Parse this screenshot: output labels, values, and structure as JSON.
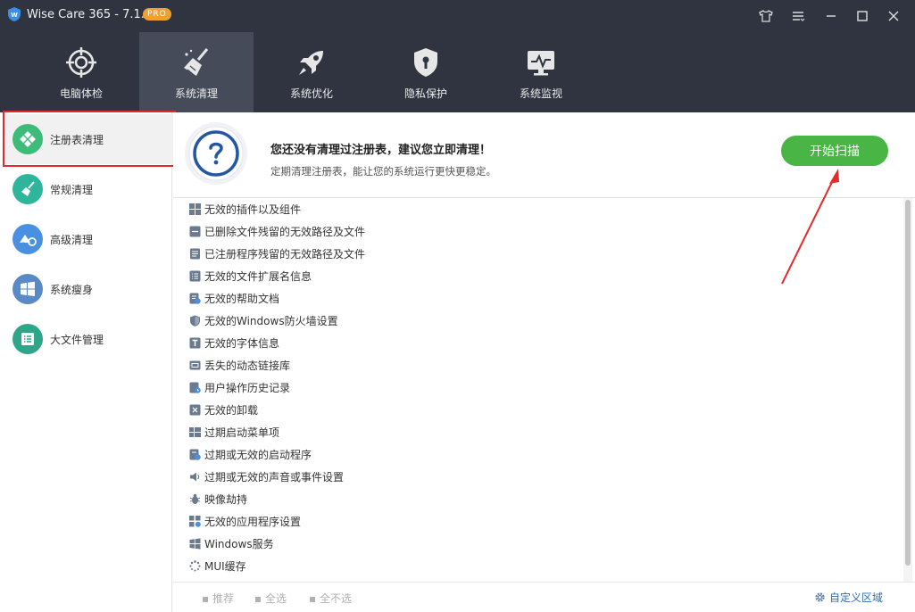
{
  "window": {
    "title": "Wise Care 365 - 7.1.1",
    "badge": "PRO"
  },
  "nav": {
    "tabs": [
      {
        "label": "电脑体检",
        "icon": "target-icon"
      },
      {
        "label": "系统清理",
        "icon": "broom-icon",
        "active": true
      },
      {
        "label": "系统优化",
        "icon": "rocket-icon"
      },
      {
        "label": "隐私保护",
        "icon": "shield-icon"
      },
      {
        "label": "系统监视",
        "icon": "monitor-icon"
      }
    ]
  },
  "sidebar": {
    "items": [
      {
        "label": "注册表清理",
        "color": "#3dbb78",
        "active": true
      },
      {
        "label": "常规清理",
        "color": "#2fb59c"
      },
      {
        "label": "高级清理",
        "color": "#4a90e2"
      },
      {
        "label": "系统瘦身",
        "color": "#5a8ac6"
      },
      {
        "label": "大文件管理",
        "color": "#2fa58a"
      }
    ]
  },
  "banner": {
    "title": "您还没有清理过注册表，建议您立即清理！",
    "subtitle": "定期清理注册表，能让您的系统运行更快更稳定。",
    "scan_button": "开始扫描"
  },
  "list": {
    "items": [
      {
        "label": "无效的插件以及组件",
        "icon": "grid-icon"
      },
      {
        "label": "已删除文件残留的无效路径及文件",
        "icon": "file-icon"
      },
      {
        "label": "已注册程序残留的无效路径及文件",
        "icon": "document-icon"
      },
      {
        "label": "无效的文件扩展名信息",
        "icon": "list-icon"
      },
      {
        "label": "无效的帮助文档",
        "icon": "help-doc-icon"
      },
      {
        "label": "无效的Windows防火墙设置",
        "icon": "firewall-icon"
      },
      {
        "label": "无效的字体信息",
        "icon": "font-icon"
      },
      {
        "label": "丢失的动态链接库",
        "icon": "dll-icon"
      },
      {
        "label": "用户操作历史记录",
        "icon": "history-icon"
      },
      {
        "label": "无效的卸载",
        "icon": "uninstall-icon"
      },
      {
        "label": "过期启动菜单项",
        "icon": "menu-icon"
      },
      {
        "label": "过期或无效的启动程序",
        "icon": "startup-icon"
      },
      {
        "label": "过期或无效的声音或事件设置",
        "icon": "sound-icon"
      },
      {
        "label": "映像劫持",
        "icon": "bug-icon"
      },
      {
        "label": "无效的应用程序设置",
        "icon": "app-settings-icon"
      },
      {
        "label": "Windows服务",
        "icon": "windows-icon"
      },
      {
        "label": "MUI缓存",
        "icon": "spinner-icon"
      }
    ]
  },
  "footer": {
    "recommend": "推荐",
    "select_all": "全选",
    "select_none": "全不选",
    "custom_area": "自定义区域"
  },
  "colors": {
    "accent_green": "#48b545",
    "titlebar": "#2f3440",
    "highlight": "#e32b2b"
  }
}
